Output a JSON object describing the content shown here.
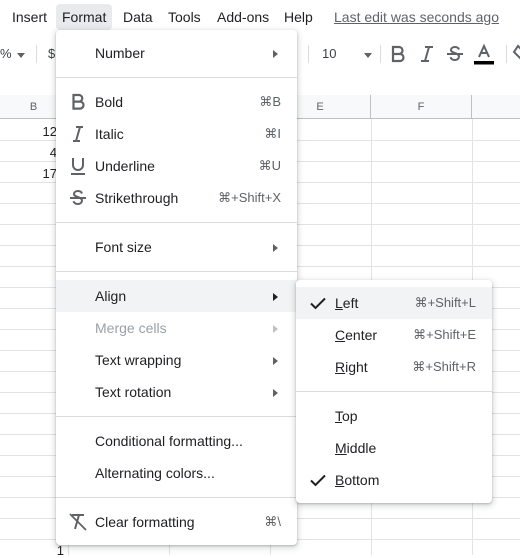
{
  "menubar": {
    "items": [
      "Insert",
      "Format",
      "Data",
      "Tools",
      "Add-ons",
      "Help"
    ],
    "last_edit": "Last edit was seconds ago"
  },
  "toolbar": {
    "zoom_fragment": "%",
    "currency_fragment": "$",
    "font_size": "10"
  },
  "grid": {
    "columns": [
      "B",
      "E",
      "F"
    ],
    "cells": [
      "12",
      "4",
      "17"
    ],
    "bottom_row_fragment": "1"
  },
  "format_menu": {
    "number": "Number",
    "bold": {
      "label": "Bold",
      "shortcut": "⌘B"
    },
    "italic": {
      "label": "Italic",
      "shortcut": "⌘I"
    },
    "underline": {
      "label": "Underline",
      "shortcut": "⌘U"
    },
    "strikethrough": {
      "label": "Strikethrough",
      "shortcut": "⌘+Shift+X"
    },
    "font_size": "Font size",
    "align": "Align",
    "merge_cells": "Merge cells",
    "text_wrapping": "Text wrapping",
    "text_rotation": "Text rotation",
    "conditional_formatting": "Conditional formatting...",
    "alternating_colors": "Alternating colors...",
    "clear_formatting": {
      "label": "Clear formatting",
      "shortcut": "⌘\\"
    }
  },
  "align_menu": {
    "left": {
      "first": "L",
      "rest": "eft",
      "shortcut": "⌘+Shift+L",
      "checked": true
    },
    "center": {
      "first": "C",
      "rest": "enter",
      "shortcut": "⌘+Shift+E",
      "checked": false
    },
    "right": {
      "first": "R",
      "rest": "ight",
      "shortcut": "⌘+Shift+R",
      "checked": false
    },
    "top": {
      "first": "T",
      "rest": "op",
      "checked": false
    },
    "middle": {
      "first": "M",
      "rest": "iddle",
      "checked": false
    },
    "bottom": {
      "first": "B",
      "rest": "ottom",
      "checked": true
    }
  },
  "colors": {
    "text_color_bar": "#000000",
    "hover_bg": "#f1f3f4",
    "disabled_text": "#9aa0a6"
  }
}
